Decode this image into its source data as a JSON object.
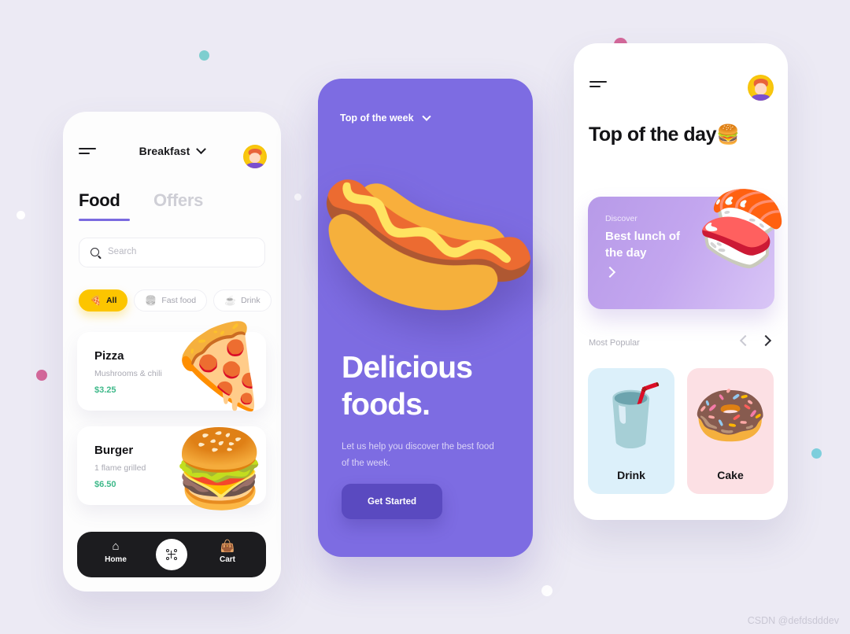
{
  "background": {
    "color": "#eceaf4"
  },
  "watermark": {
    "text": "CSDN @defdsdddev"
  },
  "left_phone": {
    "header": {
      "menu_icon": "hamburger-icon",
      "title": "Breakfast",
      "chevron": "chevron-down-icon",
      "avatar": "user-avatar"
    },
    "tabs": [
      {
        "label": "Food",
        "active": true
      },
      {
        "label": "Offers",
        "active": false
      }
    ],
    "search": {
      "placeholder": "Search",
      "value": "",
      "icon": "search-icon"
    },
    "chips": [
      {
        "label": "All",
        "glyph": "🍕",
        "icon": "pizza-icon",
        "active": true
      },
      {
        "label": "Fast food",
        "glyph": "🍔",
        "icon": "burger-icon",
        "active": false
      },
      {
        "label": "Drink",
        "glyph": "☕",
        "icon": "coffee-icon",
        "active": false
      }
    ],
    "food_cards": [
      {
        "name": "Pizza",
        "desc": "Mushrooms & chili",
        "price": "$3.25",
        "glyph": "🍕",
        "icon": "pizza-image"
      },
      {
        "name": "Burger",
        "desc": "1 flame grilled",
        "price": "$6.50",
        "glyph": "🍔",
        "icon": "burger-image"
      }
    ],
    "bottom_nav": [
      {
        "label": "Home",
        "glyph": "⌂",
        "icon": "home-icon",
        "active": true
      },
      {
        "label": "Cart",
        "glyph": "👜",
        "icon": "cart-icon",
        "active": false
      }
    ],
    "fab": {
      "icon": "grid-apps-icon"
    }
  },
  "middle_phone": {
    "top_label": "Top of the week",
    "chevron": "chevron-down-icon",
    "hero_glyph": "🌭",
    "hero_icon": "hotdog-image",
    "headline": "Delicious foods.",
    "subtext": "Let us help you discover the best food of the week.",
    "cta_label": "Get Started",
    "accent": "#7d6ce2",
    "cta_color": "#5a4ac0"
  },
  "right_phone": {
    "menu_icon": "hamburger-icon",
    "avatar": "user-avatar",
    "headline": "Top of the day",
    "headline_emoji": "🍔",
    "discover": {
      "kicker": "Discover",
      "title": "Best lunch of the day",
      "arrow": "arrow-right-icon",
      "glyph": "🍣",
      "image_icon": "sushi-image",
      "gradient_from": "#b79ae8",
      "gradient_to": "#d9c6f6"
    },
    "section_title": "Most Popular",
    "carousel": {
      "prev": "chevron-left-icon",
      "next": "arrow-right-icon"
    },
    "popular_cards": [
      {
        "label": "Drink",
        "glyph": "🥤",
        "icon": "drink-image",
        "bg": "#dcf0fa"
      },
      {
        "label": "Cake",
        "glyph": "🍩",
        "icon": "donut-image",
        "bg": "#fce0e4"
      }
    ]
  },
  "decor_dots": [
    {
      "name": "dot-blue-top",
      "color": "#7ececf"
    },
    {
      "name": "dot-pink-left",
      "color": "#d4689a"
    },
    {
      "name": "dot-white-left",
      "color": "#ffffff"
    },
    {
      "name": "dot-white-mid",
      "color": "#ffffff"
    },
    {
      "name": "dot-pink-top-right",
      "color": "#d4689a"
    },
    {
      "name": "dot-blue-right",
      "color": "#7fd0dd"
    },
    {
      "name": "dot-white-bottom",
      "color": "#ffffff"
    }
  ]
}
